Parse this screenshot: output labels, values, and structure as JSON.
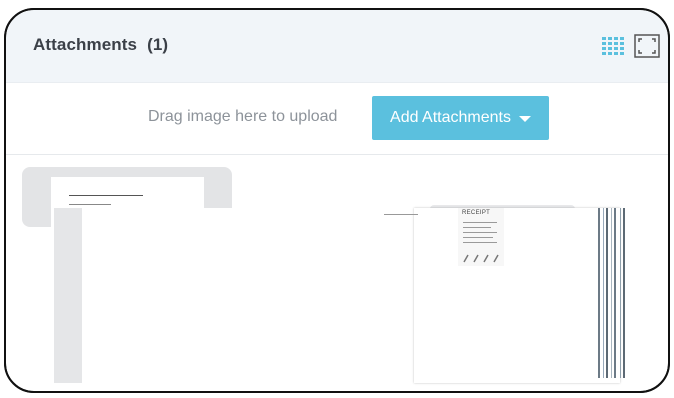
{
  "header": {
    "title": "Attachments",
    "count": "(1)"
  },
  "upload": {
    "drag_text": "Drag image here to upload",
    "add_button_label": "Add Attachments"
  },
  "attachments": [
    {
      "doc_title_text": "",
      "receipt_label": "RECEIPT"
    }
  ],
  "colors": {
    "accent": "#5bc0de",
    "grid_icon": "#5bc0de",
    "header_bg": "#f1f5f9"
  },
  "icons": {
    "grid_view": "grid-view-icon",
    "fullscreen": "fullscreen-icon",
    "caret": "caret-down-icon"
  }
}
